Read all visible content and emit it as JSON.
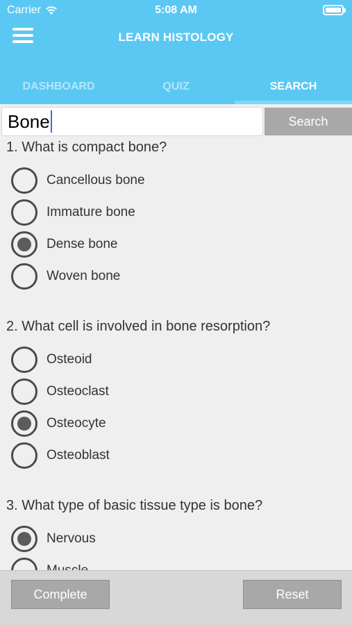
{
  "status_bar": {
    "carrier": "Carrier",
    "time": "5:08 AM"
  },
  "header": {
    "title": "LEARN HISTOLOGY"
  },
  "tabs": [
    {
      "label": "DASHBOARD",
      "active": false
    },
    {
      "label": "QUIZ",
      "active": false
    },
    {
      "label": "SEARCH",
      "active": true
    }
  ],
  "search": {
    "value": "Bone",
    "button_label": "Search"
  },
  "questions": [
    {
      "text": "1. What is compact bone?",
      "options": [
        {
          "label": "Cancellous bone",
          "selected": false
        },
        {
          "label": "Immature bone",
          "selected": false
        },
        {
          "label": "Dense bone",
          "selected": true
        },
        {
          "label": "Woven bone",
          "selected": false
        }
      ]
    },
    {
      "text": "2. What cell is involved in bone resorption?",
      "options": [
        {
          "label": "Osteoid",
          "selected": false
        },
        {
          "label": "Osteoclast",
          "selected": false
        },
        {
          "label": "Osteocyte",
          "selected": true
        },
        {
          "label": "Osteoblast",
          "selected": false
        }
      ]
    },
    {
      "text": "3. What type of basic tissue type is bone?",
      "options": [
        {
          "label": "Nervous",
          "selected": true
        },
        {
          "label": "Muscle",
          "selected": false
        }
      ]
    }
  ],
  "footer": {
    "complete_label": "Complete",
    "reset_label": "Reset"
  },
  "colors": {
    "header": "#5ac8f2",
    "button": "#a8a8a8"
  }
}
